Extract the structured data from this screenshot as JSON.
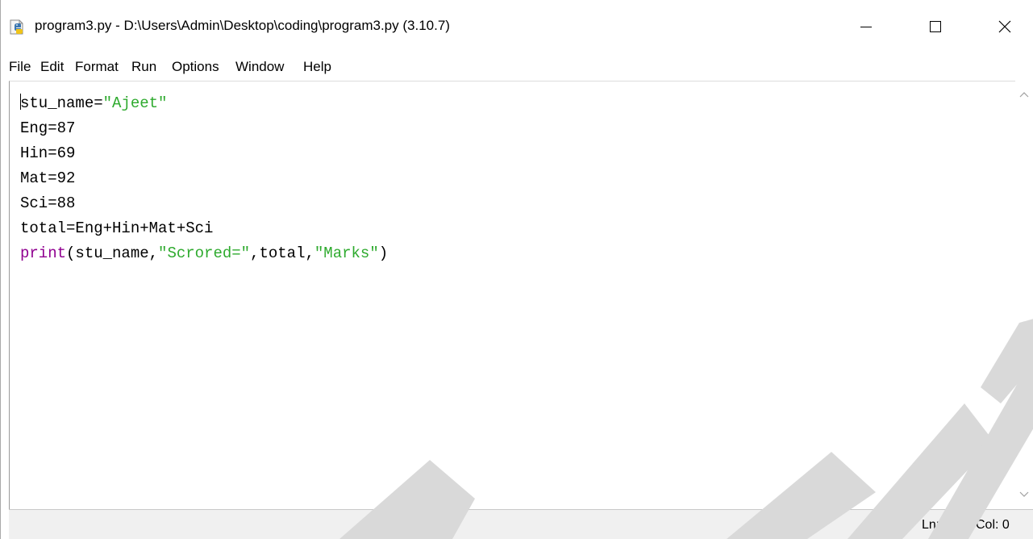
{
  "window": {
    "title": "program3.py - D:\\Users\\Admin\\Desktop\\coding\\program3.py (3.10.7)",
    "icon": "python-file-icon",
    "controls": {
      "minimize_icon": "minimize-icon",
      "maximize_icon": "maximize-icon",
      "close_icon": "close-icon"
    }
  },
  "menu": [
    "File",
    "Edit",
    "Format",
    "Run",
    "Options",
    "Window",
    "Help"
  ],
  "editor": {
    "lines": [
      [
        {
          "t": "stu_name=",
          "k": "plain"
        },
        {
          "t": "\"Ajeet\"",
          "k": "str"
        }
      ],
      [
        {
          "t": "Eng=87",
          "k": "plain"
        }
      ],
      [
        {
          "t": "Hin=69",
          "k": "plain"
        }
      ],
      [
        {
          "t": "Mat=92",
          "k": "plain"
        }
      ],
      [
        {
          "t": "Sci=88",
          "k": "plain"
        }
      ],
      [
        {
          "t": "total=Eng+Hin+Mat+Sci",
          "k": "plain"
        }
      ],
      [
        {
          "t": "print",
          "k": "builtin"
        },
        {
          "t": "(stu_name,",
          "k": "plain"
        },
        {
          "t": "\"Scrored=\"",
          "k": "str"
        },
        {
          "t": ",total,",
          "k": "plain"
        },
        {
          "t": "\"Marks\"",
          "k": "str"
        },
        {
          "t": ")",
          "k": "plain"
        }
      ]
    ],
    "colors": {
      "string": "#2eaa2e",
      "builtin": "#900090",
      "text": "#000000"
    }
  },
  "status": {
    "ln": "Ln: 1",
    "col": "Col: 0"
  }
}
